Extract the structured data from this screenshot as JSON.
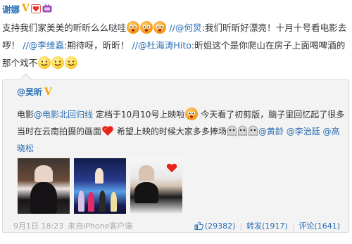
{
  "post": {
    "author": "谢娜",
    "text_intro": "支持我们家美美的昕昕么么哒哇",
    "mention1": "//@何炅",
    "text1": ":我们昕昕好漂亮！十月十号看电影去啰！",
    "mention2": "//@李维嘉",
    "text2": ":期待呀，昕昕！",
    "mention3": "//@杜海涛Hito",
    "text3": ":昕姐这个是你爬山在房子上面喝啤酒的那个戏不"
  },
  "quote": {
    "author": "@吴昕",
    "text_a": "电影",
    "link_movie": "@电影北回归线",
    "text_b": " 定档于10月10号上映啦",
    "text_c": " 今天看了初剪版，脑子里回忆起了很多当时在云南拍摄的画面",
    "text_d": " 希望上映的时候大家多多捧场",
    "mention_a": "@黄龄",
    "mention_b": "@李治廷",
    "mention_c": "@高晓松",
    "time": "9月1日 18:23",
    "source": "来自iPhone客户端",
    "likes": "(29382)",
    "reposts_label": "转发",
    "reposts": "(1917)",
    "comments_label": "评论",
    "comments": "(1641)"
  },
  "colors": {
    "link": "#2a6eb4",
    "verified": "#f5a400",
    "quote_bg": "#f3f3f3"
  },
  "icons": {
    "verified": "verified-v-icon",
    "heart_badge": "heart-badge-icon",
    "tv_badge": "tv-badge-icon",
    "like": "thumb-up-icon"
  }
}
